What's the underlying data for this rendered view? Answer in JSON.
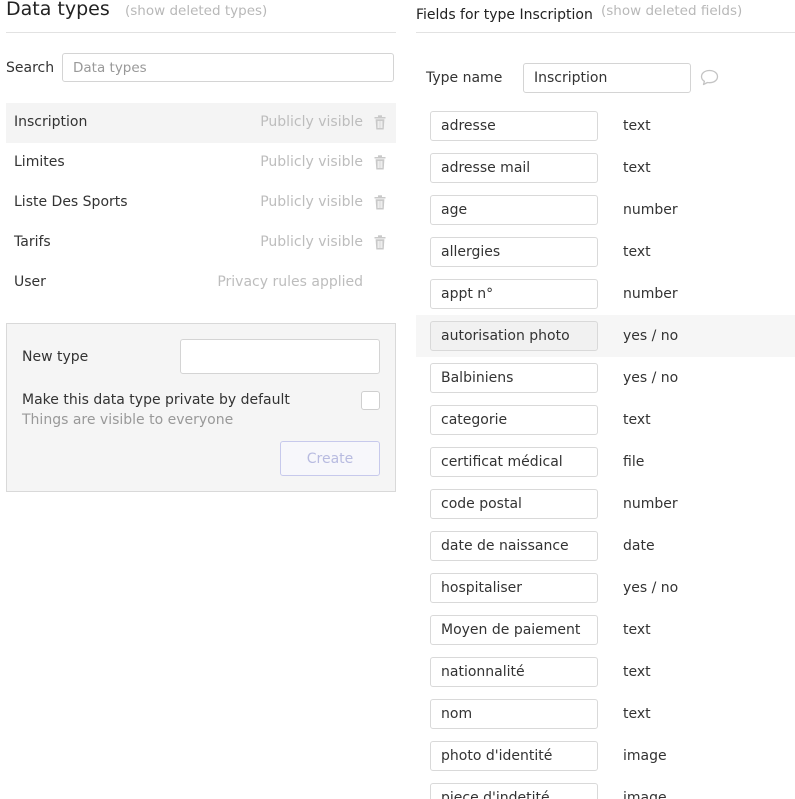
{
  "left": {
    "title": "Data types",
    "show_deleted": "(show deleted types)",
    "search": {
      "label": "Search",
      "placeholder": "Data types",
      "value": ""
    },
    "types": [
      {
        "name": "Inscription",
        "visibility": "Publicly visible",
        "selected": true,
        "deletable": true
      },
      {
        "name": "Limites",
        "visibility": "Publicly visible",
        "selected": false,
        "deletable": true
      },
      {
        "name": "Liste Des Sports",
        "visibility": "Publicly visible",
        "selected": false,
        "deletable": true
      },
      {
        "name": "Tarifs",
        "visibility": "Publicly visible",
        "selected": false,
        "deletable": true
      },
      {
        "name": "User",
        "visibility": "Privacy rules applied",
        "selected": false,
        "deletable": false
      }
    ],
    "new_type": {
      "label": "New type",
      "value": "",
      "private_label": "Make this data type private by default",
      "private_sub": "Things are visible to everyone",
      "private_checked": false,
      "create_label": "Create"
    }
  },
  "right": {
    "title": "Fields for type Inscription",
    "show_deleted": "(show deleted fields)",
    "type_name_label": "Type name",
    "type_name_value": "Inscription",
    "fields": [
      {
        "name": "adresse",
        "type": "text"
      },
      {
        "name": "adresse mail",
        "type": "text"
      },
      {
        "name": "age",
        "type": "number"
      },
      {
        "name": "allergies",
        "type": "text"
      },
      {
        "name": "appt n°",
        "type": "number"
      },
      {
        "name": "autorisation photo",
        "type": "yes / no",
        "hovered": true
      },
      {
        "name": "Balbiniens",
        "type": "yes / no"
      },
      {
        "name": "categorie",
        "type": "text"
      },
      {
        "name": "certificat médical",
        "type": "file"
      },
      {
        "name": "code postal",
        "type": "number"
      },
      {
        "name": "date de naissance",
        "type": "date"
      },
      {
        "name": "hospitaliser",
        "type": "yes / no"
      },
      {
        "name": "Moyen de paiement",
        "type": "text"
      },
      {
        "name": "nationnalité",
        "type": "text"
      },
      {
        "name": "nom",
        "type": "text"
      },
      {
        "name": "photo d'identité",
        "type": "image"
      },
      {
        "name": "piece d'indetité",
        "type": "image"
      }
    ]
  },
  "colors": {
    "muted_text": "#bdbdbd",
    "selected_row": "#f4f4f4",
    "panel_bg": "#f5f5f5",
    "create_border": "#c7c9ec"
  },
  "icons": [
    "trash-icon",
    "comment-icon"
  ]
}
